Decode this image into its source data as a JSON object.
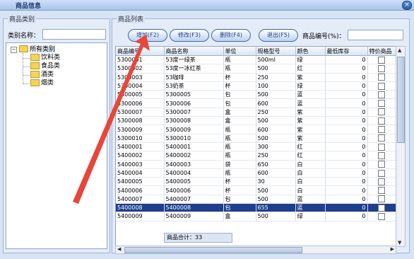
{
  "window": {
    "title": "商品信息",
    "close_glyph": "×"
  },
  "left_panel": {
    "group_title": "商品类别",
    "category_name_label": "类别名称：",
    "category_name_value": "",
    "tree": {
      "root": "所有类别",
      "children": [
        "饮料类",
        "食品类",
        "酒类",
        "烟类"
      ]
    }
  },
  "right_panel": {
    "group_title": "商品列表",
    "buttons": {
      "add": "增加(F2)",
      "edit": "修改(F3)",
      "delete": "删除(F4)",
      "exit": "退出(F5)"
    },
    "code_label": "商品编号(%)：",
    "code_value": "",
    "columns": [
      "商品编号",
      "商品名称",
      "单位",
      "规格型号",
      "颜色",
      "最低库存",
      "特价商品"
    ],
    "rows": [
      [
        "5300001",
        "53度一绿茶",
        "瓶",
        "500ml",
        "绿",
        "0"
      ],
      [
        "5300002",
        "53度一冰红茶",
        "瓶",
        "500",
        "红",
        "0"
      ],
      [
        "5300003",
        "53咖啡",
        "杯",
        "250",
        "紫",
        "0"
      ],
      [
        "5300004",
        "53奶茶",
        "杯",
        "100",
        "绿",
        "0"
      ],
      [
        "5300005",
        "5300005",
        "包",
        "500",
        "蓝",
        "0"
      ],
      [
        "5300006",
        "5300006",
        "包",
        "600",
        "蓝",
        "0"
      ],
      [
        "5300007",
        "5300007",
        "盒",
        "250",
        "紫",
        "0"
      ],
      [
        "5300008",
        "5300008",
        "盒",
        "500",
        "紫",
        "0"
      ],
      [
        "5300009",
        "5300009",
        "瓶",
        "600",
        "紫",
        "0"
      ],
      [
        "5300010",
        "5300010",
        "瓶",
        "500",
        "紫",
        "0"
      ],
      [
        "5400001",
        "5400001",
        "瓶",
        "300",
        "红",
        "0"
      ],
      [
        "5400002",
        "5400002",
        "瓶",
        "250",
        "红",
        "0"
      ],
      [
        "5400003",
        "5400003",
        "袋",
        "650",
        "白",
        "0"
      ],
      [
        "5400004",
        "5400004",
        "瓶",
        "600",
        "白",
        "0"
      ],
      [
        "5400005",
        "5400005",
        "杯",
        "30",
        "白",
        "0"
      ],
      [
        "5400006",
        "5400006",
        "杯",
        "500",
        "白",
        "0"
      ],
      [
        "5400007",
        "5400007",
        "包",
        "500",
        "蓝",
        "0"
      ],
      [
        "5400008",
        "5400008",
        "包",
        "655",
        "蓝",
        "0"
      ],
      [
        "5400009",
        "5400009",
        "盒",
        "500",
        "绿",
        "0"
      ]
    ],
    "selected_row_index": 17,
    "footer_total": "商品合计：33"
  },
  "colors": {
    "annotation_arrow": "#e8463a",
    "selection": "#1f3f8c"
  }
}
